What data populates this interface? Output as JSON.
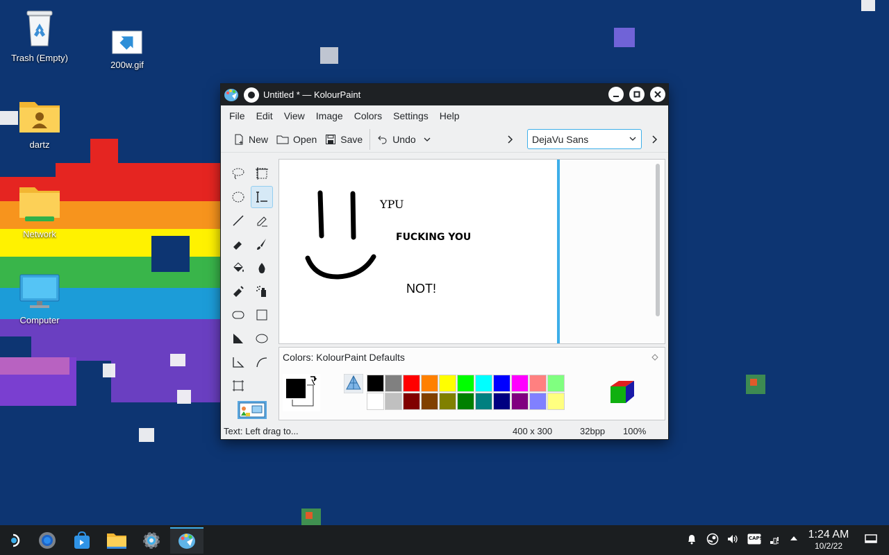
{
  "desktop": {
    "icons": [
      {
        "label": "Trash (Empty)",
        "icon": "trash-icon"
      },
      {
        "label": "200w.gif",
        "icon": "image-file-icon"
      },
      {
        "label": "dartz",
        "icon": "home-folder-icon"
      },
      {
        "label": "Network",
        "icon": "network-folder-icon"
      },
      {
        "label": "Computer",
        "icon": "computer-icon"
      }
    ]
  },
  "window": {
    "title": "Untitled * — KolourPaint",
    "menu": [
      "File",
      "Edit",
      "View",
      "Image",
      "Colors",
      "Settings",
      "Help"
    ],
    "toolbar": {
      "new_label": "New",
      "open_label": "Open",
      "save_label": "Save",
      "undo_label": "Undo",
      "font_value": "DejaVu Sans"
    },
    "canvas_text": {
      "t1": "YPU",
      "t2": "FUCKING YOU",
      "t3": "NOT!"
    },
    "palette": {
      "title": "Colors: KolourPaint Defaults",
      "row1": [
        "#000000",
        "#808080",
        "#ff0000",
        "#ff8000",
        "#ffff00",
        "#00ff00",
        "#00ffff",
        "#0000ff",
        "#ff00ff",
        "#ff8080",
        "#80ff80"
      ],
      "row2": [
        "#ffffff",
        "#c0c0c0",
        "#800000",
        "#804000",
        "#808000",
        "#008000",
        "#008080",
        "#000080",
        "#800080",
        "#8080ff",
        "#ffff80"
      ],
      "foreground": "#000000",
      "background": "#ffffff"
    },
    "status": {
      "hint": "Text: Left drag to...",
      "size": "400 x 300",
      "depth": "32bpp",
      "zoom": "100%"
    }
  },
  "taskbar": {
    "time": "1:24 AM",
    "date": "10/2/22",
    "caps_label": "CAPS"
  },
  "colors": {
    "accent": "#3daee9",
    "desktop_bg": "#0d3572",
    "titlebar": "#1e2124"
  }
}
